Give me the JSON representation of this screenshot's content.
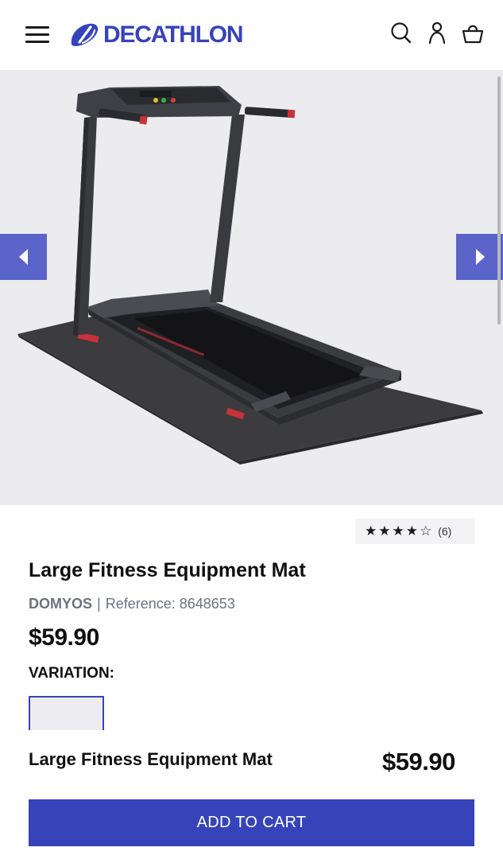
{
  "header": {
    "logo_text": "DECATHLON",
    "brand_color": "#3643BA",
    "icons": [
      "menu-icon",
      "search-icon",
      "account-icon",
      "cart-icon"
    ]
  },
  "gallery": {
    "background": "#ececef",
    "arrow_color": "#5b64c8",
    "prev_icon": "chevron-left-icon",
    "next_icon": "chevron-right-icon"
  },
  "product": {
    "rating_stars": "★★★★☆",
    "rating_value": 4.5,
    "rating_count": "(6)",
    "title": "Large Fitness Equipment Mat",
    "brand": "DOMYOS",
    "separator": "|",
    "reference": "Reference: 8648653",
    "price": "$59.90",
    "variation_label": "VARIATION:"
  },
  "sticky_bar": {
    "title": "Large Fitness Equipment Mat",
    "price": "$59.90",
    "add_to_cart_label": "ADD TO CART"
  }
}
